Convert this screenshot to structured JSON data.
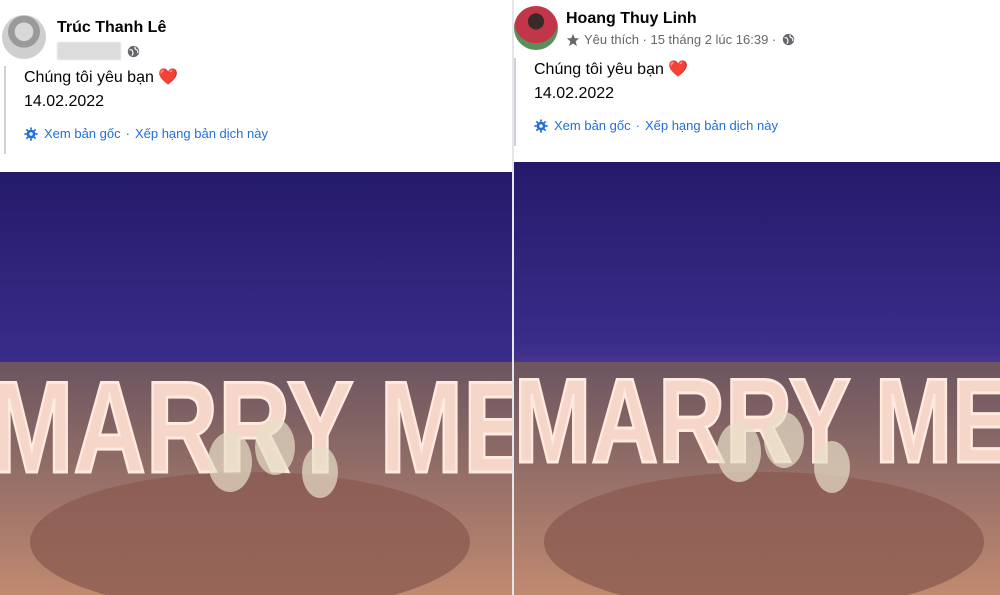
{
  "posts": [
    {
      "author": "Trúc Thanh Lê",
      "text": "Chúng tôi yêu bạn",
      "date": "14.02.2022",
      "see_original": "Xem bản gốc",
      "rate_translation": "Xếp hạng bản dịch này",
      "sign_text": "MARRY ME"
    },
    {
      "author": "Hoang Thuy Linh",
      "meta": "Yêu thích · 15 tháng 2 lúc 16:39 ·",
      "text": "Chúng tôi yêu bạn",
      "date": "14.02.2022",
      "see_original": "Xem bản gốc",
      "rate_translation": "Xếp hạng bản dịch này",
      "sign_text": "MARRY ME"
    }
  ],
  "separator": "·",
  "icons": {
    "globe": "globe-icon",
    "star": "star-icon",
    "gear": "gear-icon",
    "heart": "heart-icon"
  },
  "colors": {
    "link": "#216fdb",
    "heart": "#e41e3f",
    "sky_top": "#1a1460",
    "sky_bottom": "#c46a7c",
    "sand": "#b8866a"
  }
}
